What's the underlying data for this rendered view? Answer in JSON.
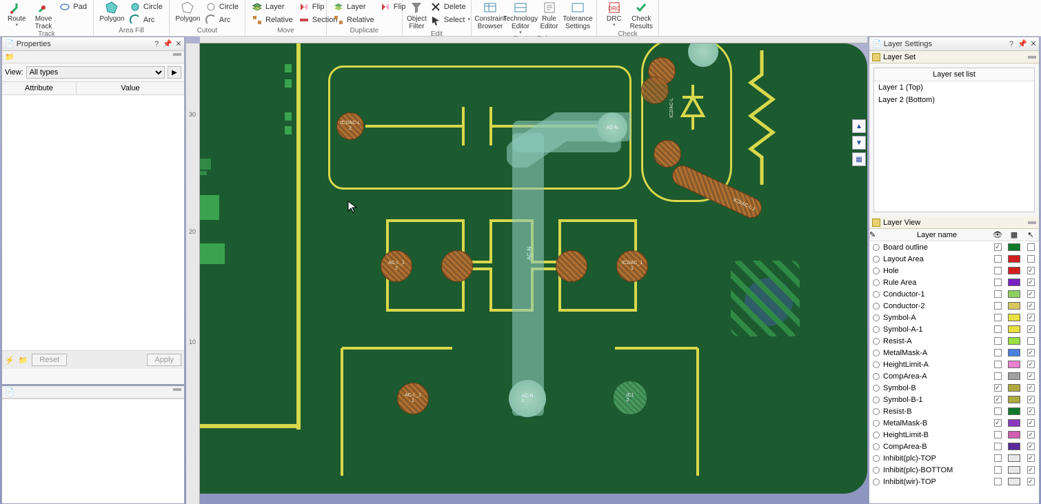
{
  "ribbon": {
    "track": {
      "title": "Track",
      "route": "Route",
      "moveTrack": "Move\nTrack",
      "pad": "Pad"
    },
    "areaFill": {
      "title": "Area Fill",
      "polygon": "Polygon",
      "circle": "Circle",
      "arc": "Arc"
    },
    "cutout": {
      "title": "Cutout",
      "polygon": "Polygon",
      "circle": "Circle",
      "arc": "Arc"
    },
    "move": {
      "title": "Move",
      "layer": "Layer",
      "relative": "Relative",
      "flip": "Flip",
      "section": "Section"
    },
    "duplicate": {
      "title": "Duplicate",
      "layer": "Layer",
      "relative": "Relative",
      "flip": "Flip"
    },
    "edit": {
      "title": "Edit",
      "objectFilter": "Object\nFilter",
      "delete": "Delete",
      "select": "Select"
    },
    "designRules": {
      "title": "Design Rules",
      "constraintBrowser": "Constraint\nBrowser",
      "technologyEditor": "Technology\nEditor",
      "ruleEditor": "Rule\nEditor",
      "toleranceSettings": "Tolerance\nSettings"
    },
    "check": {
      "title": "Check",
      "drc": "DRC",
      "checkResults": "Check\nResults"
    }
  },
  "propertiesPanel": {
    "title": "Properties",
    "viewLabel": "View:",
    "viewOption": "All types",
    "colAttribute": "Attribute",
    "colValue": "Value",
    "reset": "Reset",
    "apply": "Apply"
  },
  "layerSettingsPanel": {
    "title": "Layer Settings",
    "layerSet": "Layer Set",
    "layerSetListHeader": "Layer set list",
    "layerSets": [
      "Layer 1 (Top)",
      "Layer 2 (Bottom)"
    ],
    "layerView": "Layer View",
    "colLayerName": "Layer name",
    "layers": [
      {
        "name": "Board outline",
        "color": "#0c7a2a",
        "vis": true,
        "pick": false
      },
      {
        "name": "Layout Area",
        "color": "#d02020",
        "vis": false,
        "pick": false
      },
      {
        "name": "Hole",
        "color": "#d02020",
        "vis": false,
        "pick": true
      },
      {
        "name": "Rule Area",
        "color": "#7a20c0",
        "vis": false,
        "pick": true
      },
      {
        "name": "Conductor-1",
        "color": "#8cd060",
        "vis": false,
        "pick": true
      },
      {
        "name": "Conductor-2",
        "color": "#d8c860",
        "vis": false,
        "pick": true
      },
      {
        "name": "Symbol-A",
        "color": "#e8e040",
        "vis": false,
        "pick": true
      },
      {
        "name": "Symbol-A-1",
        "color": "#e8e040",
        "vis": false,
        "pick": true
      },
      {
        "name": "Resist-A",
        "color": "#9ae040",
        "vis": false,
        "pick": false
      },
      {
        "name": "MetalMask-A",
        "color": "#4a80e0",
        "vis": false,
        "pick": true
      },
      {
        "name": "HeightLimit-A",
        "color": "#e880d0",
        "vis": false,
        "pick": true
      },
      {
        "name": "CompArea-A",
        "color": "#a0a0a0",
        "vis": false,
        "pick": true
      },
      {
        "name": "Symbol-B",
        "color": "#b0a840",
        "vis": true,
        "pick": true
      },
      {
        "name": "Symbol-B-1",
        "color": "#b0a840",
        "vis": true,
        "pick": true
      },
      {
        "name": "Resist-B",
        "color": "#107a2a",
        "vis": false,
        "pick": true
      },
      {
        "name": "MetalMask-B",
        "color": "#8a3ac0",
        "vis": true,
        "pick": true
      },
      {
        "name": "HeightLimit-B",
        "color": "#d060b0",
        "vis": false,
        "pick": true
      },
      {
        "name": "CompArea-B",
        "color": "#5a2a9a",
        "vis": false,
        "pick": true
      },
      {
        "name": "Inhibit(plc)-TOP",
        "color": "#e8e8e8",
        "vis": false,
        "pick": true
      },
      {
        "name": "Inhibit(plc)-BOTTOM",
        "color": "#e8e8e8",
        "vis": false,
        "pick": true
      },
      {
        "name": "Inhibit(wir)-TOP",
        "color": "#e8e8e8",
        "vis": false,
        "pick": true
      }
    ]
  },
  "ruler": {
    "t30": "30",
    "t20": "20",
    "t10": "10"
  },
  "pads": {
    "p1": "IC2/AC-L\n2",
    "p2": "AC-N",
    "p3": "AC-L_1\n2",
    "p4": "IC2/AC_1\n1",
    "p5": "AC-L_1\n1",
    "p6": "AC-N\n1",
    "p7": "IC1\n2",
    "net": "AC-N",
    "ic2acl1": "IC2/AC-L 1"
  }
}
